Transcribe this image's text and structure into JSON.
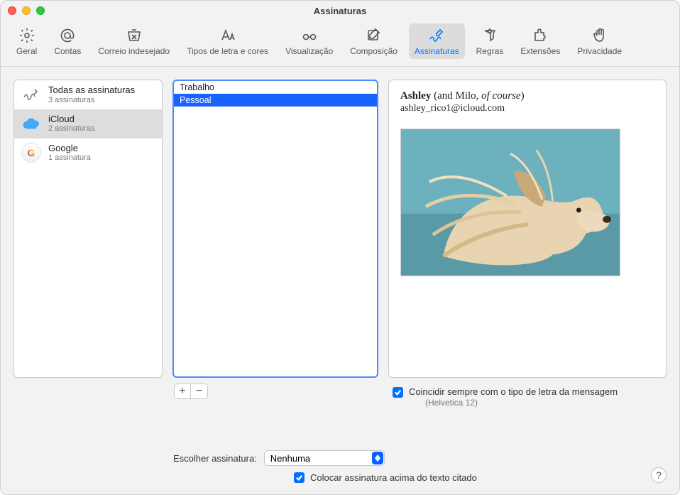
{
  "window": {
    "title": "Assinaturas"
  },
  "toolbar": {
    "items": [
      {
        "label": "Geral"
      },
      {
        "label": "Contas"
      },
      {
        "label": "Correio indesejado"
      },
      {
        "label": "Tipos de letra e cores"
      },
      {
        "label": "Visualização"
      },
      {
        "label": "Composição"
      },
      {
        "label": "Assinaturas",
        "active": true
      },
      {
        "label": "Regras"
      },
      {
        "label": "Extensões"
      },
      {
        "label": "Privacidade"
      }
    ]
  },
  "accounts": [
    {
      "name": "Todas as assinaturas",
      "sub": "3 assinaturas"
    },
    {
      "name": "iCloud",
      "sub": "2 assinaturas",
      "selected": true
    },
    {
      "name": "Google",
      "sub": "1 assinatura"
    }
  ],
  "signatures": [
    {
      "name": "Trabalho"
    },
    {
      "name": "Pessoal",
      "selected": true
    }
  ],
  "buttons": {
    "add": "+",
    "remove": "−"
  },
  "preview": {
    "name_bold": "Ashley",
    "name_rest": " (and Milo, ",
    "name_italic": "of course",
    "name_close": ")",
    "email": "ashley_rico1@icloud.com"
  },
  "options": {
    "match_font": "Coincidir sempre com o tipo de letra da mensagem",
    "match_font_sub": "(Helvetica 12)",
    "choose_label": "Escolher assinatura:",
    "choose_value": "Nenhuma",
    "place_above": "Colocar assinatura acima do texto citado"
  },
  "help": "?"
}
